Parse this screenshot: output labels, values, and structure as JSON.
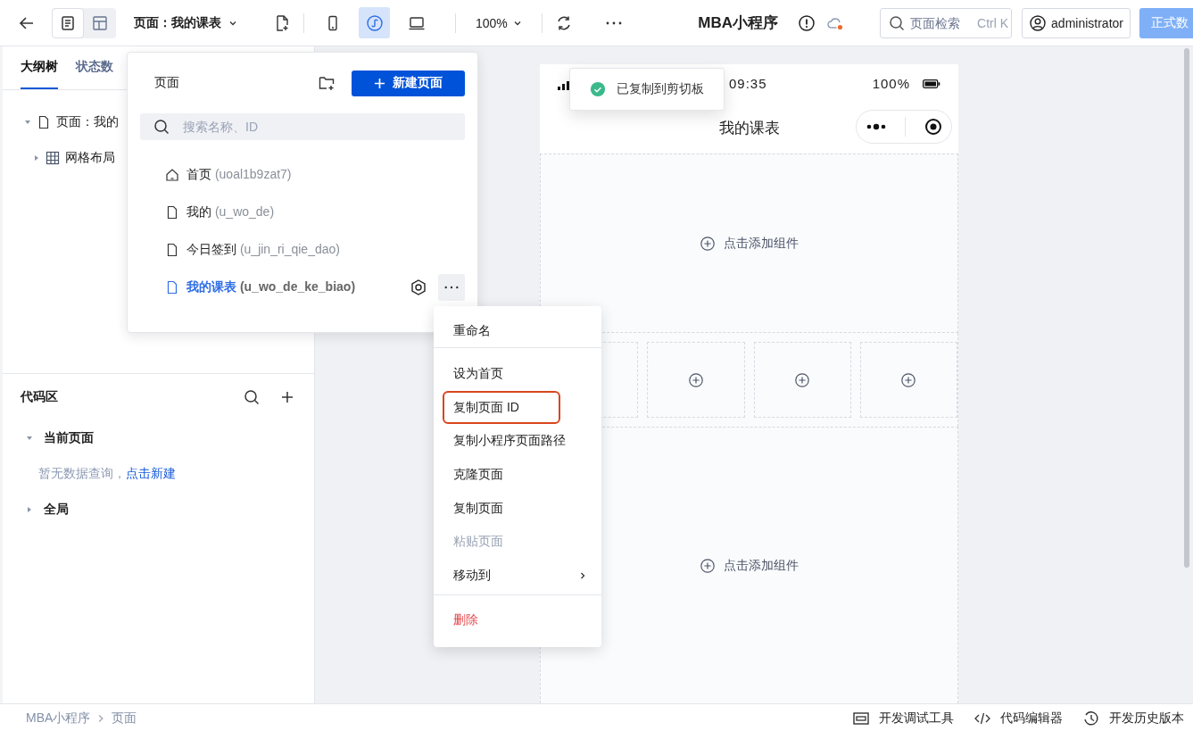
{
  "toolbar": {
    "view_toggles": [
      {
        "kind": "list",
        "selected": true
      },
      {
        "kind": "layout",
        "selected": false
      }
    ],
    "page_select": "页面：我的课表",
    "devices": [
      {
        "kind": "phone",
        "selected": false
      },
      {
        "kind": "mini",
        "selected": true
      },
      {
        "kind": "laptop",
        "selected": false
      }
    ],
    "zoom": "100%",
    "app_title": "MBA小程序",
    "search": {
      "placeholder": "页面检索",
      "shortcut": "Ctrl K"
    },
    "user": "administrator",
    "publish_button": "正式数"
  },
  "left_tabs": [
    {
      "label": "大纲树",
      "selected": true
    },
    {
      "label": "状态数",
      "selected": false
    }
  ],
  "outline": [
    {
      "label": "页面：我的",
      "kind": "page",
      "expanded": true,
      "children": [
        {
          "label": "网格布局",
          "kind": "grid",
          "expanded": false
        }
      ]
    }
  ],
  "code_area": {
    "title": "代码区",
    "sections": [
      {
        "label": "当前页面",
        "expanded": true,
        "empty_text": "暂无数据查询，",
        "empty_link": "点击新建"
      },
      {
        "label": "全局",
        "expanded": false
      }
    ]
  },
  "breadcrumb": [
    "MBA小程序",
    "页面"
  ],
  "bottom_tools": [
    {
      "label": "开发调试工具",
      "kind": "panel"
    },
    {
      "label": "代码编辑器",
      "kind": "code"
    },
    {
      "label": "开发历史版本",
      "kind": "history"
    }
  ],
  "phone": {
    "time": "09:35",
    "battery": "100%",
    "title": "我的课表",
    "sections": [
      {
        "kind": "empty",
        "label": "点击添加组件"
      },
      {
        "kind": "grid",
        "cells": [
          {
            "kind": "blank"
          },
          {
            "kind": "add"
          },
          {
            "kind": "add"
          },
          {
            "kind": "add"
          }
        ]
      },
      {
        "kind": "empty",
        "label": "点击添加组件"
      }
    ]
  },
  "toast": "已复制到剪切板",
  "pages_panel": {
    "title": "页面",
    "new_button": "新建页面",
    "search_placeholder": "搜索名称、ID",
    "pages": [
      {
        "name": "首页",
        "id": "(uoal1b9zat7)",
        "kind": "home",
        "selected": false
      },
      {
        "name": "我的",
        "id": "(u_wo_de)",
        "kind": "page",
        "selected": false
      },
      {
        "name": "今日签到",
        "id": "(u_jin_ri_qie_dao)",
        "kind": "page",
        "selected": false
      },
      {
        "name": "我的课表",
        "id": "(u_wo_de_ke_biao)",
        "kind": "page",
        "selected": true
      }
    ]
  },
  "context_menu": {
    "groups": [
      [
        {
          "label": "重命名",
          "kind": "normal",
          "highlighted": false
        }
      ],
      [
        {
          "label": "设为首页",
          "kind": "normal",
          "highlighted": false
        },
        {
          "label": "复制页面 ID",
          "kind": "normal",
          "highlighted": true
        },
        {
          "label": "复制小程序页面路径",
          "kind": "normal",
          "highlighted": false
        },
        {
          "label": "克隆页面",
          "kind": "normal",
          "highlighted": false
        },
        {
          "label": "复制页面",
          "kind": "normal",
          "highlighted": false
        },
        {
          "label": "粘贴页面",
          "kind": "disabled",
          "highlighted": false
        },
        {
          "label": "移动到",
          "kind": "submenu",
          "highlighted": false
        }
      ],
      [
        {
          "label": "删除",
          "kind": "danger",
          "highlighted": false
        }
      ]
    ]
  }
}
